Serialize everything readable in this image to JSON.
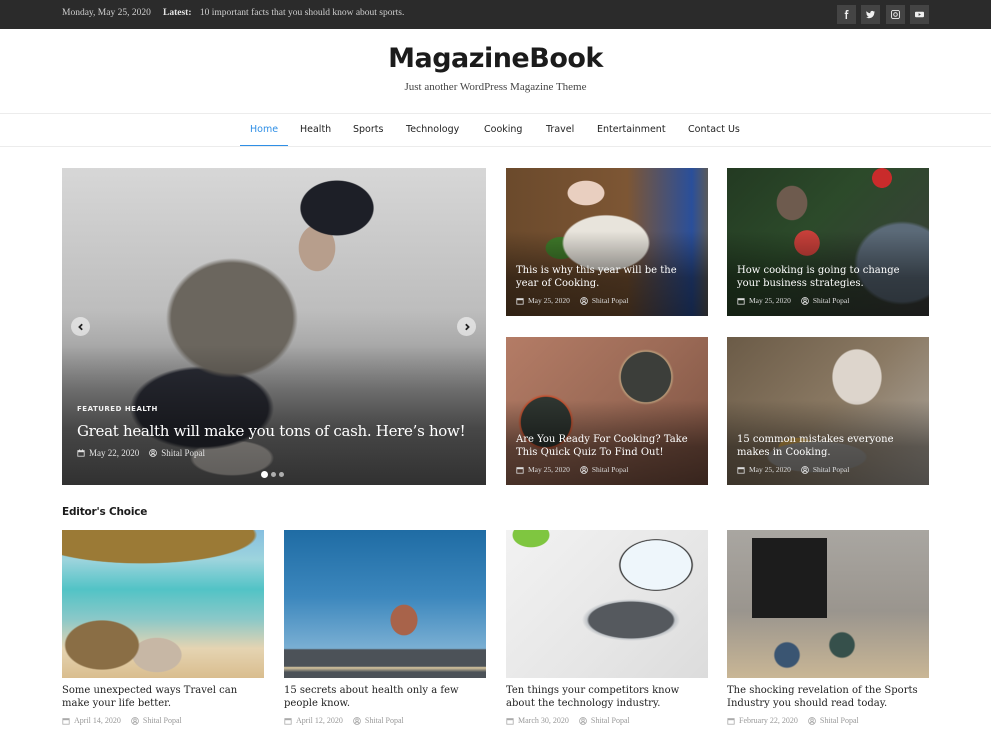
{
  "topbar": {
    "date": "Monday, May 25, 2020",
    "latest_label": "Latest:",
    "latest_text": "10 important facts that you should know about sports.",
    "social": [
      {
        "icon": "facebook-icon",
        "label": "Facebook"
      },
      {
        "icon": "twitter-icon",
        "label": "Twitter"
      },
      {
        "icon": "instagram-icon",
        "label": "Instagram"
      },
      {
        "icon": "youtube-icon",
        "label": "YouTube"
      }
    ]
  },
  "header": {
    "site_title": "MagazineBook",
    "tagline": "Just another WordPress Magazine Theme"
  },
  "nav": {
    "items": [
      {
        "label": "Home",
        "active": true
      },
      {
        "label": "Health",
        "active": false
      },
      {
        "label": "Sports",
        "active": false
      },
      {
        "label": "Technology",
        "active": false
      },
      {
        "label": "Cooking",
        "active": false
      },
      {
        "label": "Travel",
        "active": false
      },
      {
        "label": "Entertainment",
        "active": false
      },
      {
        "label": "Contact Us",
        "active": false
      }
    ],
    "accent_color": "#2f8fe6"
  },
  "hero": {
    "categories": [
      "FEATURED",
      "HEALTH"
    ],
    "title": "Great health will make you tons of cash. Here’s how!",
    "date": "May 22, 2020",
    "author": "Shital Popal",
    "slide_count": 3,
    "active_slide": 1
  },
  "grid_posts": [
    {
      "title": "This is why this year will be the year of Cooking.",
      "date": "May 25, 2020",
      "author": "Shital Popal"
    },
    {
      "title": "How cooking is going to change your business strategies.",
      "date": "May 25, 2020",
      "author": "Shital Popal"
    },
    {
      "title": "Are You Ready For Cooking? Take This Quick Quiz To Find Out!",
      "date": "May 25, 2020",
      "author": "Shital Popal"
    },
    {
      "title": "15 common mistakes everyone makes in Cooking.",
      "date": "May 25, 2020",
      "author": "Shital Popal"
    }
  ],
  "editors_choice": {
    "heading": "Editor's Choice",
    "posts": [
      {
        "title": "Some unexpected ways Travel can make your life better.",
        "date": "April 14, 2020",
        "author": "Shital Popal"
      },
      {
        "title": "15 secrets about health only a few people know.",
        "date": "April 12, 2020",
        "author": "Shital Popal"
      },
      {
        "title": "Ten things your competitors know about the technology industry.",
        "date": "March 30, 2020",
        "author": "Shital Popal"
      },
      {
        "title": "The shocking revelation of the Sports Industry you should read today.",
        "date": "February 22, 2020",
        "author": "Shital Popal"
      }
    ]
  }
}
